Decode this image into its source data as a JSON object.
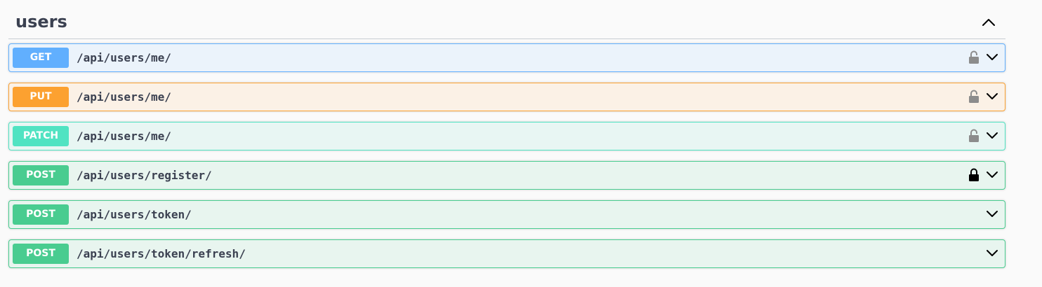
{
  "section": {
    "title": "users"
  },
  "operations": [
    {
      "method": "GET",
      "path": "/api/users/me/",
      "lock": "unlocked"
    },
    {
      "method": "PUT",
      "path": "/api/users/me/",
      "lock": "unlocked"
    },
    {
      "method": "PATCH",
      "path": "/api/users/me/",
      "lock": "unlocked"
    },
    {
      "method": "POST",
      "path": "/api/users/register/",
      "lock": "locked"
    },
    {
      "method": "POST",
      "path": "/api/users/token/",
      "lock": "none"
    },
    {
      "method": "POST",
      "path": "/api/users/token/refresh/",
      "lock": "none"
    }
  ],
  "colors": {
    "get": "#61affe",
    "put": "#fca130",
    "patch": "#50e3c2",
    "post": "#49cc90",
    "text": "#3b4151"
  },
  "icons": {
    "collapse": "chevron-up-icon",
    "expand": "chevron-down-icon",
    "unlocked": "unlocked-padlock-icon",
    "locked": "locked-padlock-icon"
  }
}
